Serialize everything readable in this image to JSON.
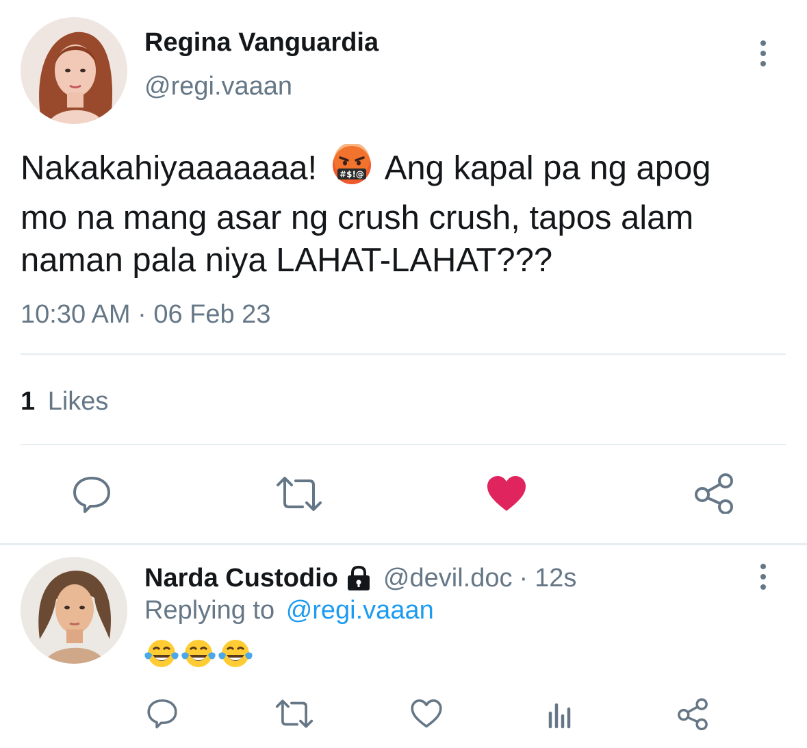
{
  "main_tweet": {
    "author": {
      "display_name": "Regina Vanguardia",
      "handle": "@regi.vaaan"
    },
    "text_line1_before_emoji": "Nakakahiyaaaaaaa!",
    "text_line1_emoji": "face-with-symbols-on-mouth",
    "text_line1_after_emoji": "Ang kapal pa ng apog",
    "text_line2": "mo na mang asar ng crush crush, tapos alam",
    "text_line3": "naman pala niya LAHAT-LAHAT???",
    "timestamp": "10:30 AM · 06 Feb 23",
    "likes_count": "1",
    "likes_label": "Likes",
    "liked": true,
    "colors": {
      "like_active": "#e0245e",
      "icon": "#657786"
    },
    "actions": [
      "reply-icon",
      "retweet-icon",
      "heart-icon",
      "share-icon"
    ]
  },
  "reply": {
    "author": {
      "display_name": "Narda Custodio",
      "protected_icon": "lock-icon",
      "handle": "@devil.doc",
      "separator": "·",
      "time": "12s"
    },
    "replying_to_label": "Replying to",
    "replying_to_handle": "@regi.vaaan",
    "emojis": [
      "face-with-tears-of-joy",
      "face-with-tears-of-joy",
      "face-with-tears-of-joy"
    ],
    "actions": [
      "reply-icon",
      "retweet-icon",
      "heart-icon",
      "analytics-icon",
      "share-icon"
    ],
    "colors": {
      "link": "#1d9bf0"
    }
  }
}
